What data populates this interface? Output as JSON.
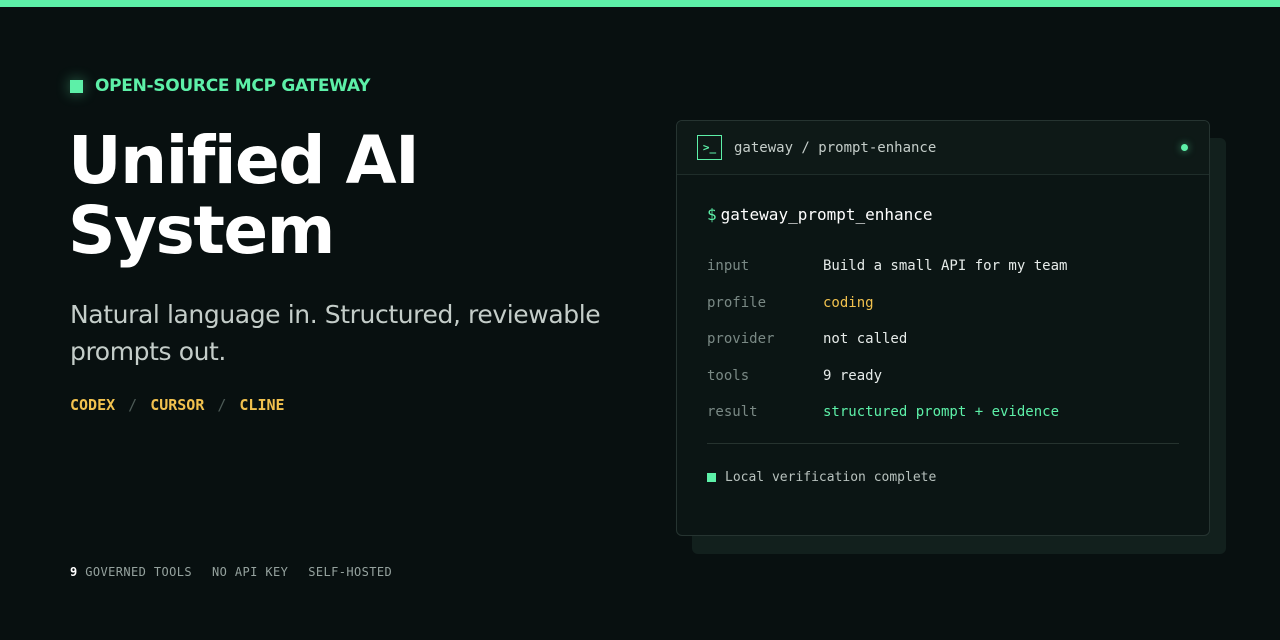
{
  "eyebrow": "OPEN-SOURCE MCP GATEWAY",
  "headline": {
    "line1": "Unified AI",
    "line2": "System"
  },
  "subtitle": "Natural language in. Structured, reviewable prompts out.",
  "clients": {
    "items": [
      "CODEX",
      "CURSOR",
      "CLINE"
    ],
    "separator": "/"
  },
  "features": {
    "tools_count": "9",
    "tools_label": "GOVERNED TOOLS",
    "api_key": "NO API KEY",
    "hosting": "SELF-HOSTED"
  },
  "terminal": {
    "icon_glyph": ">_",
    "title": "gateway / prompt-enhance",
    "prompt_symbol": "$",
    "command": "gateway_prompt_enhance",
    "rows": [
      {
        "key": "input",
        "value": "Build a small API for my team"
      },
      {
        "key": "profile",
        "value": "coding"
      },
      {
        "key": "provider",
        "value": "not called"
      },
      {
        "key": "tools",
        "value": "9 ready"
      },
      {
        "key": "result",
        "value": "structured prompt + evidence"
      }
    ],
    "status": "Local verification complete"
  },
  "colors": {
    "accent": "#5df0a8",
    "highlight": "#f1c14e",
    "background": "#081010"
  }
}
